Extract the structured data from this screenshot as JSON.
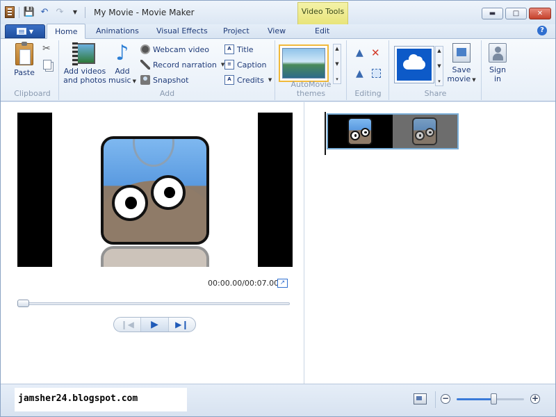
{
  "window": {
    "title": "My Movie - Movie Maker",
    "context_group": "Video Tools"
  },
  "tabs": [
    {
      "label": "Home"
    },
    {
      "label": "Animations"
    },
    {
      "label": "Visual Effects"
    },
    {
      "label": "Project"
    },
    {
      "label": "View"
    },
    {
      "label": "Edit"
    }
  ],
  "ribbon": {
    "clipboard": {
      "label": "Clipboard",
      "paste": "Paste"
    },
    "add": {
      "label": "Add",
      "add_videos_line1": "Add videos",
      "add_videos_line2": "and photos",
      "add_music_line1": "Add",
      "add_music_line2": "music",
      "webcam": "Webcam video",
      "narration": "Record narration",
      "snapshot": "Snapshot",
      "title": "Title",
      "caption": "Caption",
      "credits": "Credits"
    },
    "themes": {
      "label": "AutoMovie themes"
    },
    "editing": {
      "label": "Editing"
    },
    "share": {
      "label": "Share",
      "save_line1": "Save",
      "save_line2": "movie",
      "signin_line1": "Sign",
      "signin_line2": "in"
    }
  },
  "preview": {
    "time": "00:00.00/00:07.00",
    "seek_position": 0
  },
  "status": {
    "watermark": "jamsher24.blogspot.com",
    "zoom_level": 0.56
  },
  "colors": {
    "accent": "#1f4f9f",
    "context_tab": "#e8e47a",
    "tile_sky": "#7eb8f0",
    "clip_border": "#7aaed8"
  }
}
